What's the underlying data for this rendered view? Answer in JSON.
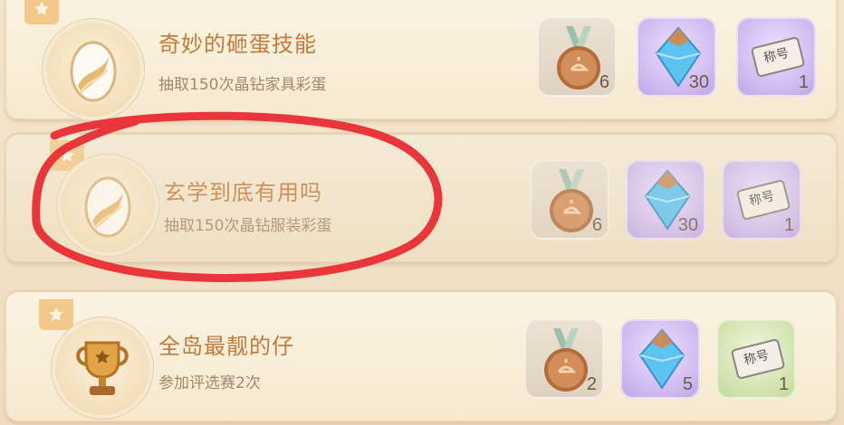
{
  "achievements": [
    {
      "title": "奇妙的砸蛋技能",
      "subtitle": "抽取150次晶钻家具彩蛋",
      "icon": "egg-icon",
      "rewards": [
        {
          "icon": "medal-icon",
          "count": "6",
          "bg": "gray"
        },
        {
          "icon": "diamond-icon",
          "count": "30",
          "bg": "purple"
        },
        {
          "icon": "title-card-icon",
          "label": "称号",
          "count": "1",
          "bg": "purple"
        }
      ]
    },
    {
      "title": "玄学到底有用吗",
      "subtitle": "抽取150次晶钻服装彩蛋",
      "icon": "egg-icon",
      "highlighted": true,
      "rewards": [
        {
          "icon": "medal-icon",
          "count": "6",
          "bg": "gray"
        },
        {
          "icon": "diamond-icon",
          "count": "30",
          "bg": "purple"
        },
        {
          "icon": "title-card-icon",
          "label": "称号",
          "count": "1",
          "bg": "purple"
        }
      ]
    },
    {
      "title": "全岛最靓的仔",
      "subtitle": "参加评选赛2次",
      "icon": "trophy-icon",
      "rewards": [
        {
          "icon": "medal-icon",
          "count": "2",
          "bg": "gray"
        },
        {
          "icon": "diamond-icon",
          "count": "5",
          "bg": "purple"
        },
        {
          "icon": "title-card-icon",
          "label": "称号",
          "count": "1",
          "bg": "green"
        }
      ]
    }
  ],
  "colors": {
    "title": "#c27a3d",
    "subtitle": "#a4876b",
    "annotation": "#e8363a"
  }
}
